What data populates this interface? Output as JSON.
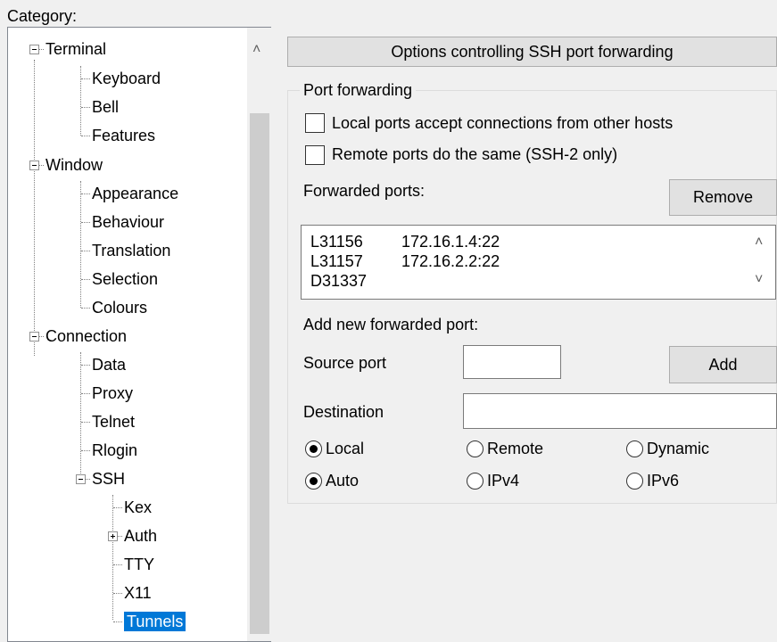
{
  "category_label": "Category:",
  "tree": {
    "items": [
      {
        "label": "Terminal"
      },
      {
        "label": "Keyboard"
      },
      {
        "label": "Bell"
      },
      {
        "label": "Features"
      },
      {
        "label": "Window"
      },
      {
        "label": "Appearance"
      },
      {
        "label": "Behaviour"
      },
      {
        "label": "Translation"
      },
      {
        "label": "Selection"
      },
      {
        "label": "Colours"
      },
      {
        "label": "Connection"
      },
      {
        "label": "Data"
      },
      {
        "label": "Proxy"
      },
      {
        "label": "Telnet"
      },
      {
        "label": "Rlogin"
      },
      {
        "label": "SSH"
      },
      {
        "label": "Kex"
      },
      {
        "label": "Auth"
      },
      {
        "label": "TTY"
      },
      {
        "label": "X11"
      },
      {
        "label": "Tunnels"
      }
    ],
    "selected": "Tunnels",
    "scroll_up_glyph": "˄"
  },
  "panel": {
    "header": "Options controlling SSH port forwarding",
    "group_title": "Port forwarding",
    "local_ports_accept": "Local ports accept connections from other hosts",
    "remote_ports_same": "Remote ports do the same (SSH-2 only)",
    "forwarded_ports_label": "Forwarded ports:",
    "remove_button": "Remove",
    "forwarded_ports": [
      {
        "port": "L31156",
        "dest": "172.16.1.4:22"
      },
      {
        "port": "L31157",
        "dest": "172.16.2.2:22"
      },
      {
        "port": "D31337",
        "dest": ""
      }
    ],
    "list_up_glyph": "˄",
    "list_down_glyph": "˅",
    "add_new_label": "Add new forwarded port:",
    "source_port_label": "Source port",
    "source_port_value": "",
    "add_button": "Add",
    "destination_label": "Destination",
    "destination_value": "",
    "radio_local": "Local",
    "radio_remote": "Remote",
    "radio_dynamic": "Dynamic",
    "radio_auto": "Auto",
    "radio_ipv4": "IPv4",
    "radio_ipv6": "IPv6"
  }
}
